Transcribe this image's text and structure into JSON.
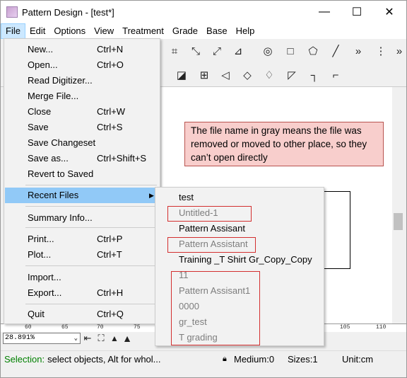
{
  "window": {
    "title": "Pattern Design - [test*]"
  },
  "window_controls": {
    "minimize": "—",
    "maximize": "☐",
    "close": "✕"
  },
  "menubar": {
    "items": [
      "File",
      "Edit",
      "Options",
      "View",
      "Treatment",
      "Grade",
      "Base",
      "Help"
    ],
    "active": "File"
  },
  "file_menu": {
    "items": [
      {
        "label": "New...",
        "shortcut": "Ctrl+N"
      },
      {
        "label": "Open...",
        "shortcut": "Ctrl+O"
      },
      {
        "label": "Read Digitizer...",
        "shortcut": ""
      },
      {
        "label": "Merge File...",
        "shortcut": ""
      },
      {
        "label": "Close",
        "shortcut": "Ctrl+W"
      },
      {
        "label": "Save",
        "shortcut": "Ctrl+S"
      },
      {
        "label": "Save Changeset",
        "shortcut": ""
      },
      {
        "label": "Save as...",
        "shortcut": "Ctrl+Shift+S"
      },
      {
        "label": "Revert to Saved",
        "shortcut": ""
      },
      {
        "label": "Recent Files",
        "shortcut": ""
      },
      {
        "label": "Summary Info...",
        "shortcut": ""
      },
      {
        "label": "Print...",
        "shortcut": "Ctrl+P"
      },
      {
        "label": "Plot...",
        "shortcut": "Ctrl+T"
      },
      {
        "label": "Import...",
        "shortcut": ""
      },
      {
        "label": "Export...",
        "shortcut": "Ctrl+H"
      },
      {
        "label": "Quit",
        "shortcut": "Ctrl+Q"
      }
    ],
    "highlighted": "Recent Files"
  },
  "recent_files": {
    "items": [
      {
        "name": "test",
        "available": true
      },
      {
        "name": "Untitled-1",
        "available": false
      },
      {
        "name": "Pattern Assisant",
        "available": true
      },
      {
        "name": "Pattern Assistant",
        "available": false
      },
      {
        "name": "Training _T Shirt Gr_Copy_Copy",
        "available": true
      },
      {
        "name": "11",
        "available": false
      },
      {
        "name": "Pattern Assisant1",
        "available": false
      },
      {
        "name": "0000",
        "available": false
      },
      {
        "name": "gr_test",
        "available": false
      },
      {
        "name": "T grading",
        "available": false
      }
    ]
  },
  "callout": {
    "text": "The file name in gray means the file was removed or moved to other place, so they can’t open directly"
  },
  "ruler": {
    "ticks": [
      "60",
      "65",
      "70",
      "75",
      "105",
      "110"
    ]
  },
  "zoom": {
    "value": "28.891%"
  },
  "statusbar": {
    "selection_label": "Selection:",
    "selection_hint": "select objects, Alt for whol...",
    "medium": "Medium:0",
    "sizes": "Sizes:1",
    "unit": "Unit:cm"
  },
  "colors": {
    "callout_bg": "#f8cecc",
    "callout_border": "#b85450",
    "highlight": "#91c9f7",
    "redbox": "#d32f2f",
    "status_green": "#008000"
  }
}
